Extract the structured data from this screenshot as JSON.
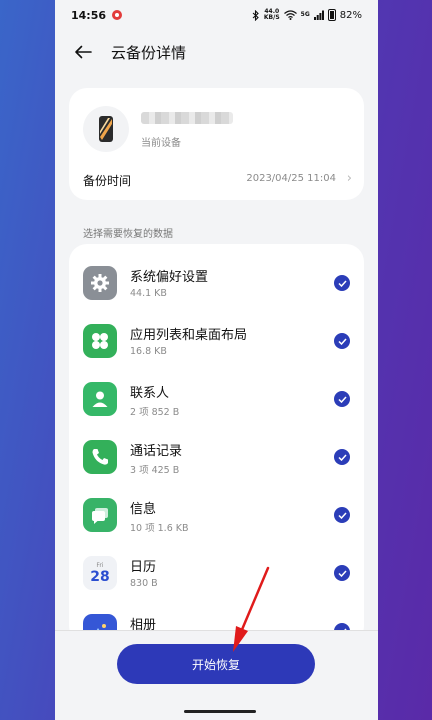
{
  "status_bar": {
    "time": "14:56",
    "icons": [
      "notification-icon",
      "bluetooth-icon",
      "wifi-icon",
      "signal-icon"
    ],
    "net_speed_value": "44.0",
    "net_speed_unit": "KB/S",
    "sim_label": "5G",
    "battery": "82%"
  },
  "header": {
    "back_icon": "arrow-left-icon",
    "title": "云备份详情"
  },
  "device": {
    "name": "",
    "subtitle": "当前设备",
    "backup_time_label": "备份时间",
    "backup_time_value": "2023/04/25 11:04"
  },
  "section_label": "选择需要恢复的数据",
  "items": [
    {
      "title": "系统偏好设置",
      "subtitle": "44.1 KB",
      "icon": "gear-icon",
      "icon_bg": "#8a8f96",
      "checked": true
    },
    {
      "title": "应用列表和桌面布局",
      "subtitle": "16.8 KB",
      "icon": "app-grid-icon",
      "icon_bg": "#33b05a",
      "checked": true
    },
    {
      "title": "联系人",
      "subtitle": "2 项   852 B",
      "icon": "person-icon",
      "icon_bg": "#35b868",
      "checked": true
    },
    {
      "title": "通话记录",
      "subtitle": "3 项   425 B",
      "icon": "phone-icon",
      "icon_bg": "#33b05a",
      "checked": true
    },
    {
      "title": "信息",
      "subtitle": "10 项   1.6 KB",
      "icon": "message-icon",
      "icon_bg": "#38b368",
      "checked": true
    },
    {
      "title": "日历",
      "subtitle": "830 B",
      "icon": "calendar-icon",
      "icon_bg": "#f0f2f6",
      "calendar_day": "Fri",
      "calendar_date": "28",
      "checked": true
    },
    {
      "title": "相册",
      "subtitle": "",
      "icon": "gallery-icon",
      "icon_bg": "#3557d6",
      "checked": true
    }
  ],
  "primary_button": "开始恢复",
  "colors": {
    "accent": "#2d39b8",
    "check": "#2b3db8",
    "annotation_arrow": "#e01b1b"
  }
}
